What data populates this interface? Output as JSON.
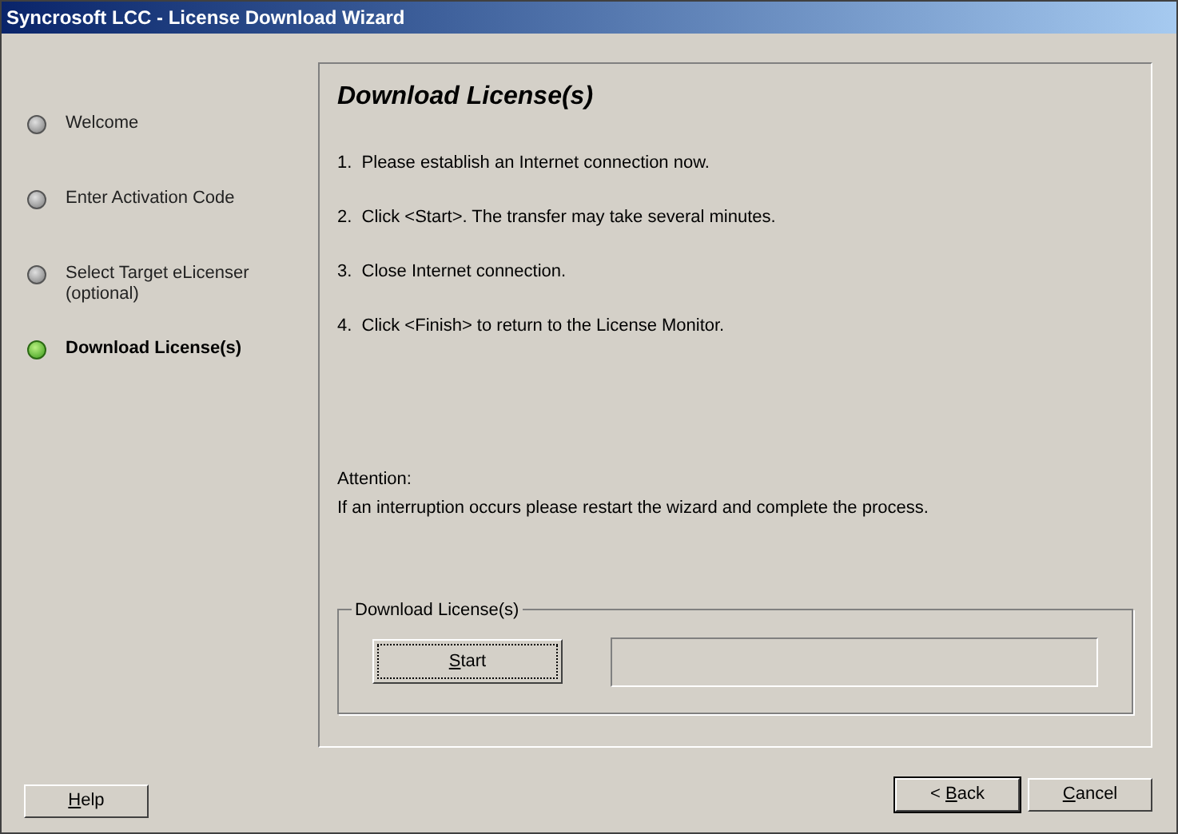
{
  "window": {
    "title": "Syncrosoft LCC - License Download Wizard"
  },
  "steps": [
    {
      "label": "Welcome",
      "selected": false
    },
    {
      "label": "Enter Activation Code",
      "selected": false
    },
    {
      "label": "Select Target eLicenser (optional)",
      "selected": false
    },
    {
      "label": "Download License(s)",
      "selected": true
    }
  ],
  "page": {
    "heading": "Download License(s)",
    "instructions": [
      "1.  Please establish an Internet connection now.",
      "2.  Click <Start>. The transfer may take several minutes.",
      "3.  Close Internet connection.",
      "4.  Click <Finish> to return to the License Monitor."
    ],
    "attention_title": "Attention:",
    "attention_text": "If an interruption occurs please restart the wizard and complete the process.",
    "group": {
      "legend": "Download License(s)",
      "start_button": {
        "accel": "S",
        "label_after": "tart",
        "focused": true
      },
      "progress": {
        "level": 0
      }
    }
  },
  "buttons": [
    {
      "accel": "H",
      "label_after": "elp",
      "default": false
    },
    {
      "label_before": "< ",
      "accel": "B",
      "label_after": "ack",
      "default": true
    },
    {
      "accel": "C",
      "label_after": "ancel",
      "default": false
    }
  ]
}
